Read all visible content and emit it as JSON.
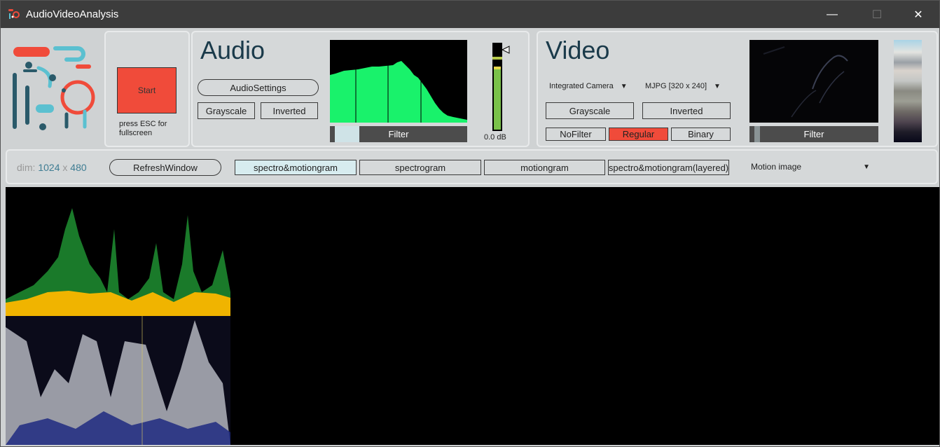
{
  "window": {
    "title": "AudioVideoAnalysis",
    "minimize": "—",
    "maximize": "☐",
    "close": "✕"
  },
  "start": {
    "button": "Start",
    "hint": "press ESC for fullscreen"
  },
  "audio": {
    "title": "Audio",
    "settings_button": "AudioSettings",
    "grayscale": "Grayscale",
    "inverted": "Inverted",
    "filter": "Filter",
    "gain_label": "0.0 dB",
    "spectrum_color": "#19f26b"
  },
  "video": {
    "title": "Video",
    "camera": "Integrated Camera",
    "format": "MJPG [320 x 240]",
    "grayscale": "Grayscale",
    "inverted": "Inverted",
    "nofilter": "NoFilter",
    "regular": "Regular",
    "binary": "Binary",
    "filter": "Filter",
    "active_color": "#f04b3a"
  },
  "toolbar": {
    "dim_label": "dim:",
    "dim_w": "1024",
    "dim_x": "x",
    "dim_h": "480",
    "refresh": "RefreshWindow",
    "tabs": [
      "spectro&motiongram",
      "spectrogram",
      "motiongram",
      "spectro&motiongram(layered)"
    ],
    "mode": "Motion image"
  },
  "colors": {
    "start_button": "#f04b3a",
    "accent_teal": "#4a8a9a"
  }
}
